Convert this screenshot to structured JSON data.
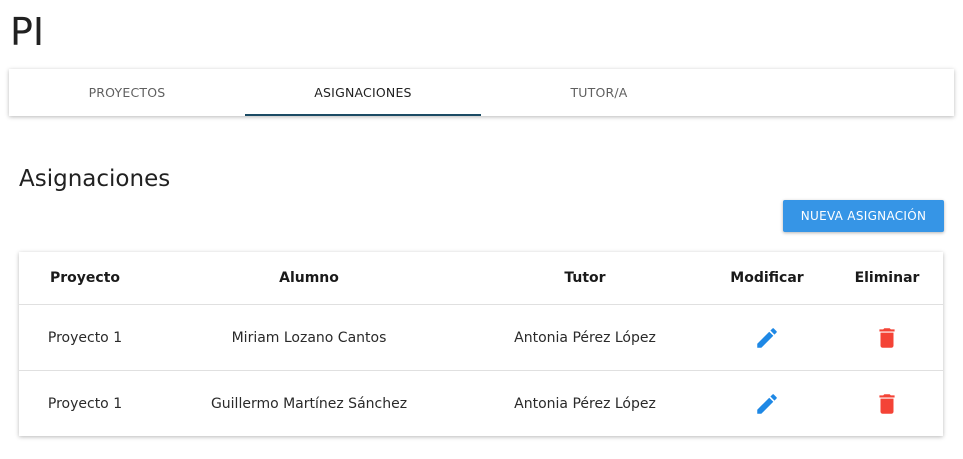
{
  "app": {
    "title": "PI"
  },
  "tabs": [
    {
      "label": "PROYECTOS",
      "active": false
    },
    {
      "label": "ASIGNACIONES",
      "active": true
    },
    {
      "label": "TUTOR/A",
      "active": false
    }
  ],
  "section": {
    "title": "Asignaciones"
  },
  "new_button": {
    "label": "NUEVA ASIGNACIÓN"
  },
  "table": {
    "headers": {
      "project": "Proyecto",
      "student": "Alumno",
      "tutor": "Tutor",
      "modify": "Modificar",
      "delete": "Eliminar"
    },
    "rows": [
      {
        "project": "Proyecto 1",
        "student": "Miriam Lozano Cantos",
        "tutor": "Antonia Pérez López",
        "modify_icon": "pencil-icon",
        "delete_icon": "trash-icon"
      },
      {
        "project": "Proyecto 1",
        "student": "Guillermo Martínez Sánchez",
        "tutor": "Antonia Pérez López",
        "modify_icon": "pencil-icon",
        "delete_icon": "trash-icon"
      }
    ]
  },
  "colors": {
    "accent": "#3695e6",
    "tab_indicator": "#1b4b64",
    "edit_icon": "#1e88e5",
    "delete_icon": "#f44336"
  }
}
